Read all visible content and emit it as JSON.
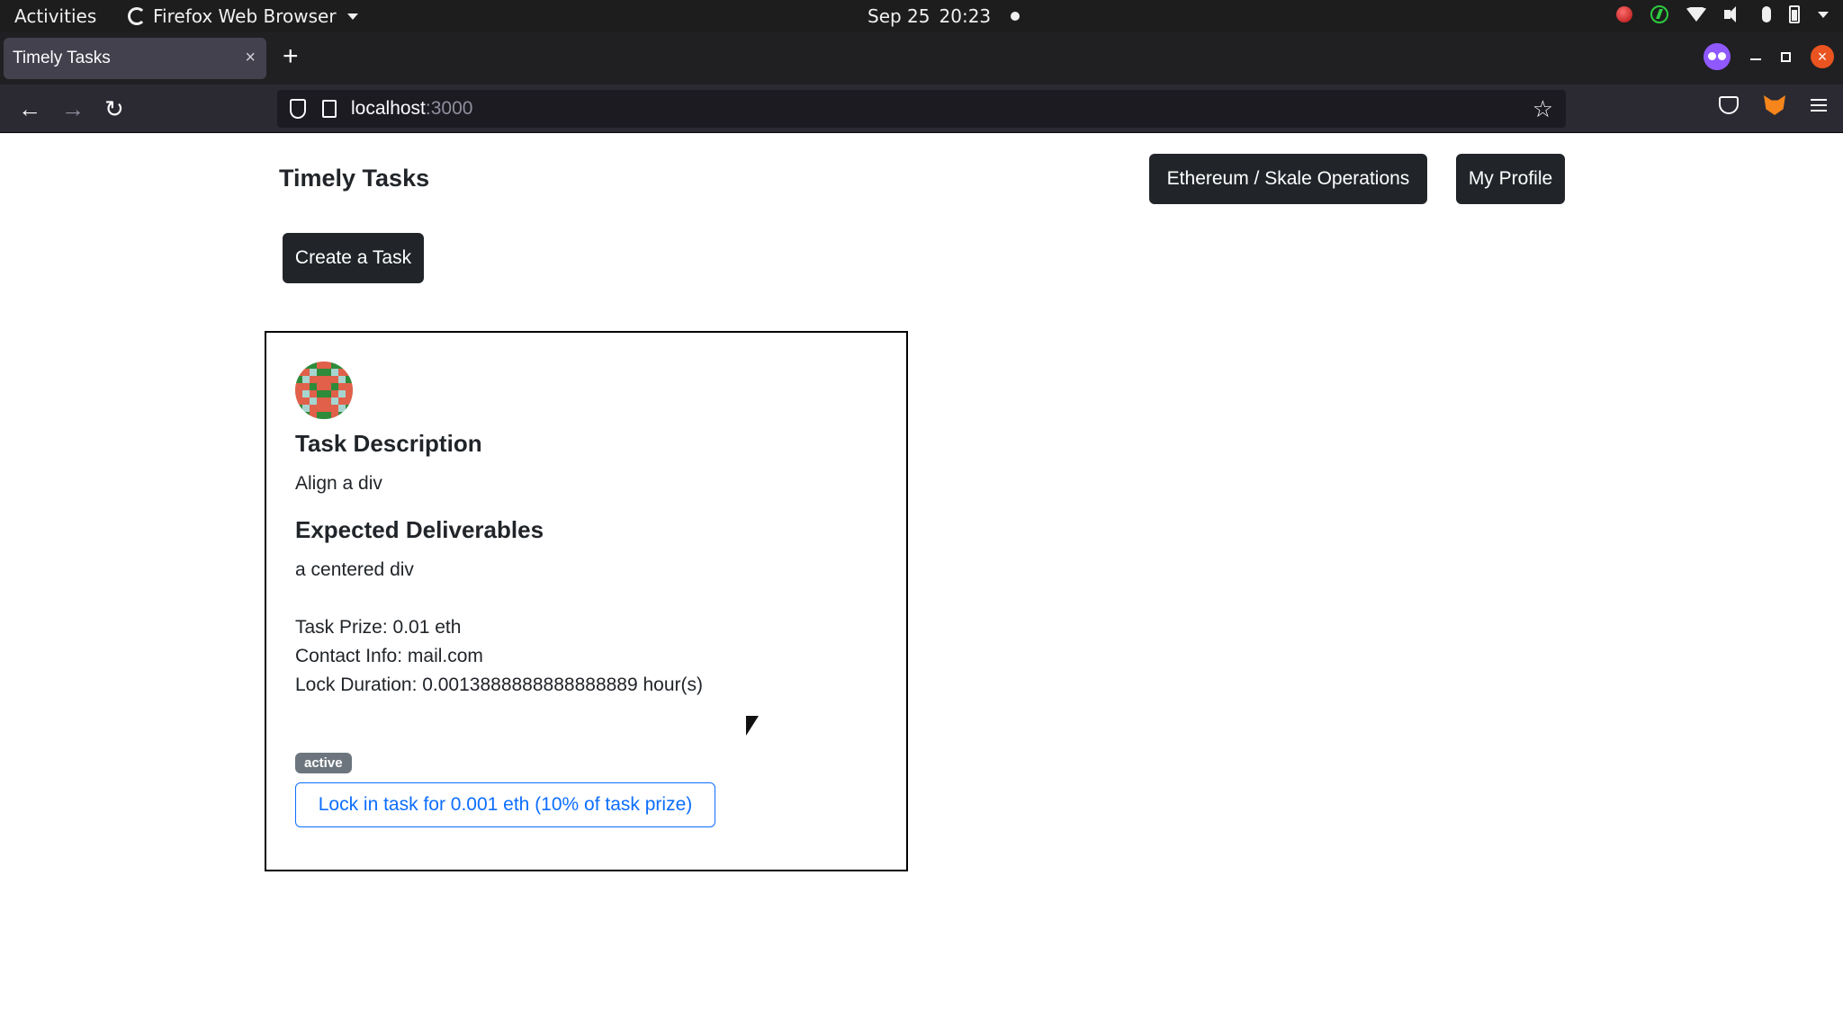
{
  "system_bar": {
    "activities": "Activities",
    "app_name": "Firefox Web Browser",
    "date": "Sep 25",
    "time": "20:23"
  },
  "browser": {
    "tab_title": "Timely Tasks",
    "tab_close": "×",
    "new_tab": "+",
    "url_host": "localhost",
    "url_port": ":3000",
    "star": "☆",
    "back": "←",
    "forward": "→",
    "reload": "↻",
    "win_close": "×"
  },
  "header": {
    "brand": "Timely Tasks",
    "ops_button": "Ethereum / Skale Operations",
    "profile_button": "My Profile"
  },
  "actions": {
    "create_task": "Create a Task"
  },
  "task_card": {
    "description_heading": "Task Description",
    "description": "Align a div",
    "deliverables_heading": "Expected Deliverables",
    "deliverables": "a centered div",
    "prize": "Task Prize: 0.01 eth",
    "contact": "Contact Info: mail.com",
    "lock_duration": "Lock Duration: 0.0013888888888888889 hour(s)",
    "status_badge": "active",
    "lock_button": "Lock in task for 0.001 eth (10% of task prize)",
    "identicon_colors": [
      "#e0604a",
      "#2e8b3a",
      "#a6d5d0"
    ]
  },
  "colors": {
    "primary_dark": "#212529",
    "outline_blue": "#0d6efd",
    "badge_gray": "#6c757d"
  }
}
